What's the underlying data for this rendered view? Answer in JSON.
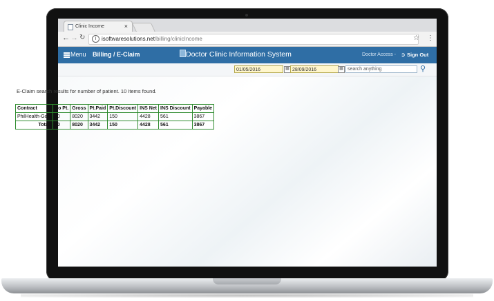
{
  "browser": {
    "tab_title": "Clinic Income",
    "tab_close": "×",
    "url_host": "isoftwaresolutions.net",
    "url_path": "/billing/clinicIncome"
  },
  "header": {
    "menu_label": "Menu",
    "breadcrumb": "Billing / E-Claim",
    "title": "Doctor Clinic Information System",
    "access": "Doctor Access -",
    "sign_out": "Sign Out",
    "brand_color": "#2f6ea5"
  },
  "search": {
    "date_from": "01/05/2016",
    "date_to": "28/09/2016",
    "placeholder": "search anything"
  },
  "results": {
    "message": "E-Claim search results for number of patient. 10 Items found.",
    "columns": [
      "Contract",
      "No Pt.",
      "Gross",
      "Pt.Paid",
      "Pt.Discount",
      "INS Net",
      "INS Discount",
      "Payable"
    ],
    "rows": [
      [
        "PhilHealth-Gold",
        "10",
        "8020",
        "3442",
        "150",
        "4428",
        "561",
        "3867"
      ]
    ],
    "total": [
      "Total:",
      "10",
      "8020",
      "3442",
      "150",
      "4428",
      "561",
      "3867"
    ]
  }
}
